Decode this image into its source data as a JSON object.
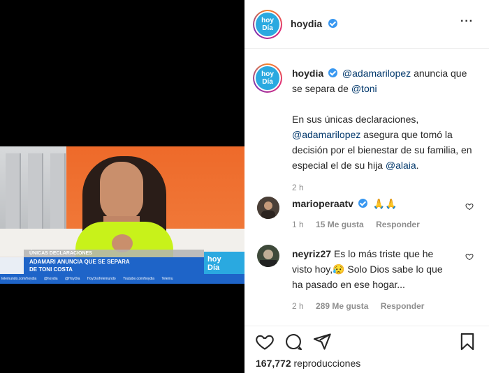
{
  "video": {
    "lower_third_top": "ÚNICAS DECLARACIONES",
    "headline_line1": "ADAMARI ANUNCIA QUE SE SEPARA",
    "headline_line2": "DE TONI COSTA",
    "logo_line1": "hoy",
    "logo_line2": "Día",
    "ticker": [
      "telemundo.com/hoydia",
      "@hoydia",
      "@HoyDia",
      "HoyDiaTelemundo",
      "Youtube.com/hoydia",
      "Telemu"
    ]
  },
  "post": {
    "author": "hoydia",
    "avatar_line1": "hoy",
    "avatar_line2": "Día",
    "more_label": "···",
    "caption": {
      "author": "hoydia",
      "mention1": "@adamarilopez",
      "text1": "anuncia que se separa de",
      "mention2": "@toni",
      "text2": "En sus únicas declaraciones,",
      "mention3": "@adamarilopez",
      "text3": "asegura que tomó la decisión por el bienestar de su familia, en especial el de su hija",
      "mention4": "@alaia",
      "text4": ".",
      "time": "2 h"
    },
    "comments": [
      {
        "user": "marioperaatv",
        "text": "🙏🙏",
        "time": "1 h",
        "likes": "15 Me gusta",
        "reply": "Responder"
      },
      {
        "user": "neyriz27",
        "text": "Es lo más triste que he visto hoy,😥 Solo Dios sabe lo que ha pasado en ese hogar...",
        "time": "2 h",
        "likes": "289 Me gusta",
        "reply": "Responder"
      }
    ],
    "views_count": "167,772",
    "views_label": "reproducciones",
    "colors": {
      "mention": "#00376b",
      "verified": "#3897f0",
      "meta": "#8e8e8e"
    }
  }
}
